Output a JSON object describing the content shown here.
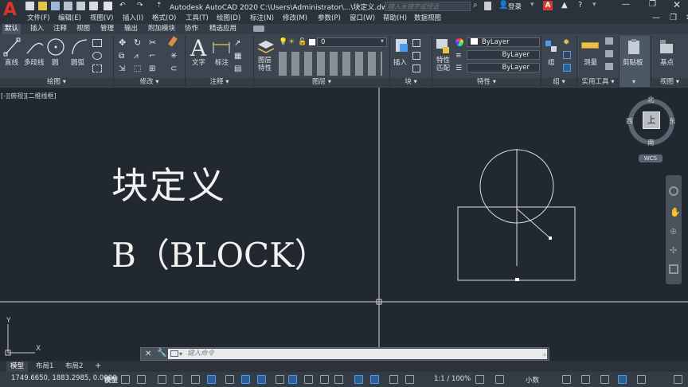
{
  "title_bar": {
    "app_logo": "A",
    "title": "Autodesk AutoCAD 2020    C:\\Users\\Administrator\\...\\块定义.dwg",
    "search_placeholder": "键入关键字或短语",
    "login": "登录"
  },
  "menu": [
    "文件(F)",
    "编辑(E)",
    "视图(V)",
    "插入(I)",
    "格式(O)",
    "工具(T)",
    "绘图(D)",
    "标注(N)",
    "修改(M)",
    "参数(P)",
    "窗口(W)",
    "帮助(H)",
    "数据视图"
  ],
  "ribbon_tabs": [
    "默认",
    "插入",
    "注释",
    "视图",
    "管理",
    "输出",
    "附加模块",
    "协作",
    "精选应用"
  ],
  "ribbon": {
    "draw": {
      "items": [
        "直线",
        "多段线",
        "圆",
        "圆弧"
      ],
      "title": "绘图"
    },
    "modify": {
      "title": "修改"
    },
    "annotation": {
      "items": [
        "文字",
        "标注"
      ],
      "title": "注释"
    },
    "layers": {
      "items": [
        "图层\n特性"
      ],
      "current_layer": "0",
      "title": "图层"
    },
    "block": {
      "items": [
        "插入"
      ],
      "title": "块"
    },
    "properties": {
      "items": [
        "特性\n匹配"
      ],
      "bylayer1": "ByLayer",
      "bylayer2": "ByLayer",
      "bylayer3": "ByLayer",
      "title": "特性"
    },
    "groups": {
      "items": [
        "组"
      ],
      "title": "组"
    },
    "utilities": {
      "items": [
        "测量"
      ],
      "title": "实用工具"
    },
    "clipboard": {
      "items": [
        "剪贴板"
      ]
    },
    "view": {
      "items": [
        "基点"
      ],
      "title": "视图"
    }
  },
  "viewport_label": "[-][俯视][二维线框]",
  "drawing_text": {
    "title": "块定义",
    "subtitle": "B（BLOCK）"
  },
  "viewcube": {
    "north": "北",
    "south": "南",
    "east": "东",
    "west": "西",
    "top": "上",
    "wcs": "WCS"
  },
  "ucs": {
    "x": "X",
    "y": "Y"
  },
  "command_line": {
    "placeholder": "键入命令"
  },
  "layout_tabs": [
    "模型",
    "布局1",
    "布局2",
    "+"
  ],
  "status": {
    "coords": "1749.6650, 1883.2985, 0.0000",
    "model": "模型",
    "scale": "1:1 / 100%",
    "units": "小数"
  },
  "colors": {
    "background": "#212830",
    "ribbon": "#3d4550",
    "accent": "#4a9cf0",
    "logo": "#e0302a"
  }
}
